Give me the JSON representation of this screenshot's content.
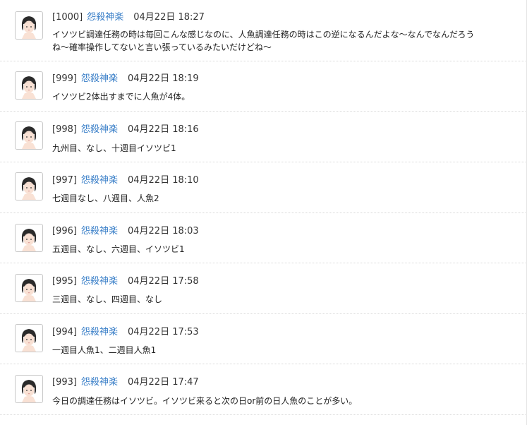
{
  "comments": [
    {
      "number": "[1000]",
      "author": "怨殺神楽",
      "date": "04月22日 18:27",
      "text": "イソツビ調達任務の時は毎回こんな感じなのに、人魚調達任務の時はこの逆になるんだよな〜なんでなんだろうね〜確率操作してないと言い張っているみたいだけどね〜"
    },
    {
      "number": "[999]",
      "author": "怨殺神楽",
      "date": "04月22日 18:19",
      "text": "イソツビ2体出すまでに人魚が4体。"
    },
    {
      "number": "[998]",
      "author": "怨殺神楽",
      "date": "04月22日 18:16",
      "text": "九州目、なし、十週目イソツビ1"
    },
    {
      "number": "[997]",
      "author": "怨殺神楽",
      "date": "04月22日 18:10",
      "text": "七週目なし、八週目、人魚2"
    },
    {
      "number": "[996]",
      "author": "怨殺神楽",
      "date": "04月22日 18:03",
      "text": "五週目、なし、六週目、イソツビ1"
    },
    {
      "number": "[995]",
      "author": "怨殺神楽",
      "date": "04月22日 17:58",
      "text": "三週目、なし、四週目、なし"
    },
    {
      "number": "[994]",
      "author": "怨殺神楽",
      "date": "04月22日 17:53",
      "text": "一週目人魚1、二週目人魚1"
    },
    {
      "number": "[993]",
      "author": "怨殺神楽",
      "date": "04月22日 17:47",
      "text": "今日の調達任務はイソツビ。イソツビ来ると次の日or前の日人魚のことが多い。"
    }
  ],
  "colors": {
    "author_link": "#3a7fc8",
    "text": "#222222",
    "divider": "#d8d8d8"
  },
  "icons": {
    "avatar": "user-avatar-icon"
  }
}
